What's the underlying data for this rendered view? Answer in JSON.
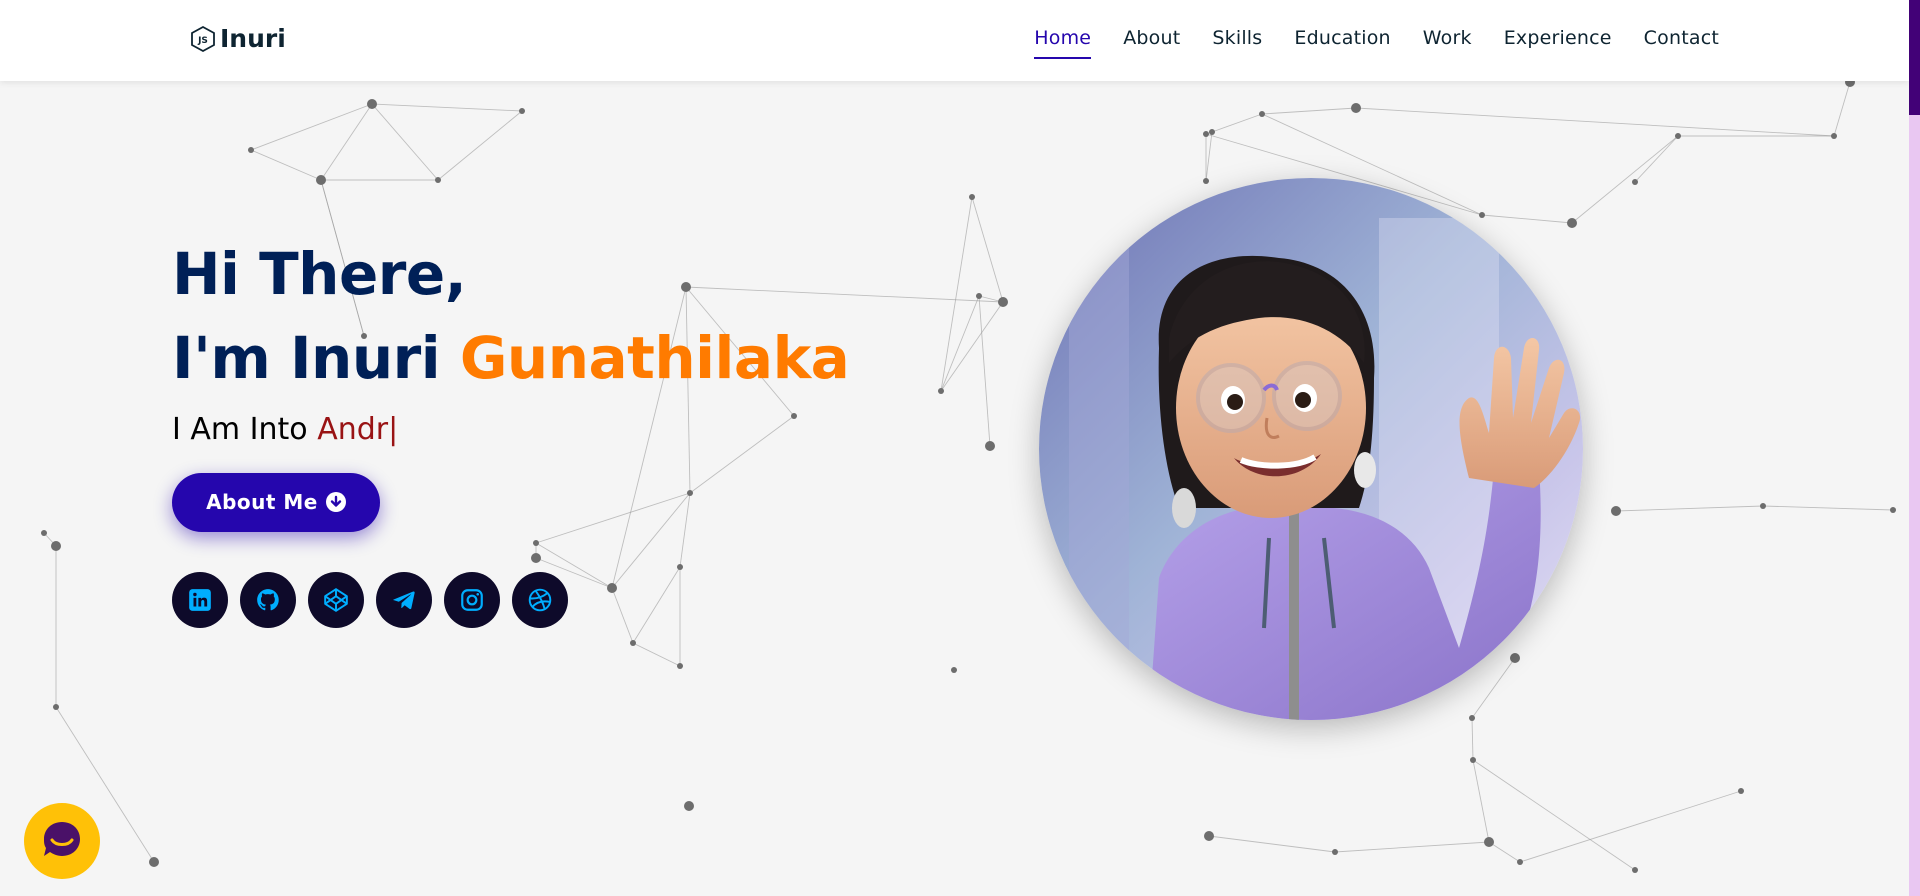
{
  "brand": {
    "logo_icon": "nodejs-hex-icon",
    "name": "Inuri"
  },
  "nav": {
    "items": [
      {
        "label": "Home",
        "active": true
      },
      {
        "label": "About",
        "active": false
      },
      {
        "label": "Skills",
        "active": false
      },
      {
        "label": "Education",
        "active": false
      },
      {
        "label": "Work",
        "active": false
      },
      {
        "label": "Experience",
        "active": false
      },
      {
        "label": "Contact",
        "active": false
      }
    ]
  },
  "hero": {
    "greeting": "Hi There,",
    "intro": "I'm Inuri",
    "surname": "Gunathilaka",
    "typing_prefix": "I Am Into",
    "typing_text": "Andr",
    "cursor": "|",
    "about_button": "About Me",
    "about_button_icon": "arrow-circle-down-icon",
    "socials": [
      {
        "name": "linkedin-icon"
      },
      {
        "name": "github-icon"
      },
      {
        "name": "codepen-icon"
      },
      {
        "name": "telegram-icon"
      },
      {
        "name": "instagram-icon"
      },
      {
        "name": "dribbble-icon"
      }
    ]
  },
  "avatar": {
    "icon": "memoji-avatar-waving"
  },
  "chat": {
    "icon": "chat-bubble-icon"
  },
  "colors": {
    "nav_active": "#2506ad",
    "heading": "#002057",
    "accent": "#ff7b00",
    "typed": "#991314",
    "button": "#2506ad",
    "social_bg": "#0e0a2a",
    "social_icon": "#00aeff",
    "chat": "#ffc107",
    "scroll_thumb": "#420177",
    "scroll_track": "#e9c7f2"
  }
}
